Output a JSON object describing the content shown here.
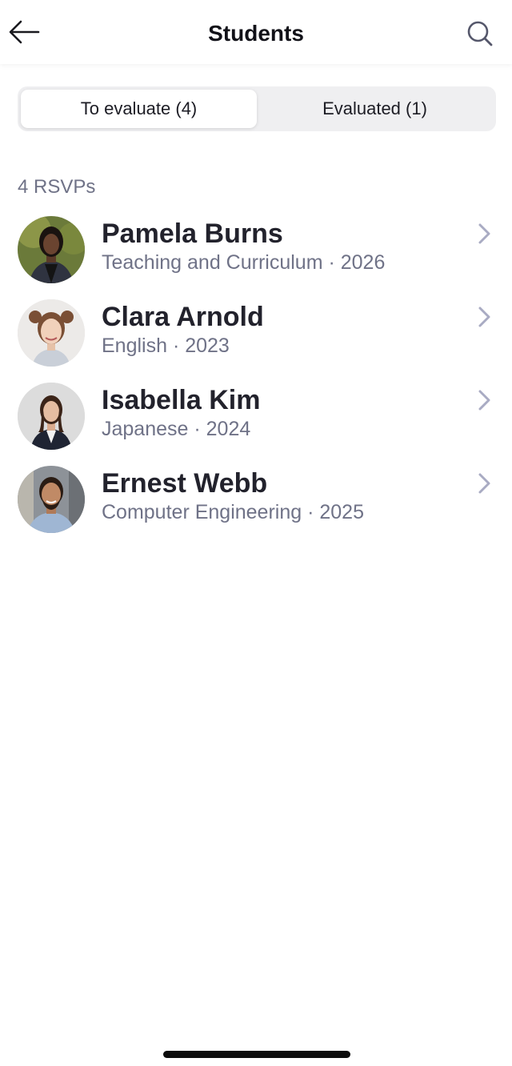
{
  "header": {
    "title": "Students",
    "back_icon": "arrow-left-icon",
    "search_icon": "search-icon"
  },
  "tabs": [
    {
      "label": "To evaluate (4)",
      "active": true
    },
    {
      "label": "Evaluated (1)",
      "active": false
    }
  ],
  "list": {
    "count_label": "4 RSVPs",
    "students": [
      {
        "name": "Pamela Burns",
        "meta": "Teaching and Curriculum · 2026"
      },
      {
        "name": "Clara Arnold",
        "meta": "English · 2023"
      },
      {
        "name": "Isabella Kim",
        "meta": "Japanese · 2024"
      },
      {
        "name": "Ernest Webb",
        "meta": "Computer Engineering · 2025"
      }
    ]
  },
  "colors": {
    "chevron": "#a9abc3",
    "secondary_text": "#6f7287",
    "segment_bg": "#efeff1"
  }
}
